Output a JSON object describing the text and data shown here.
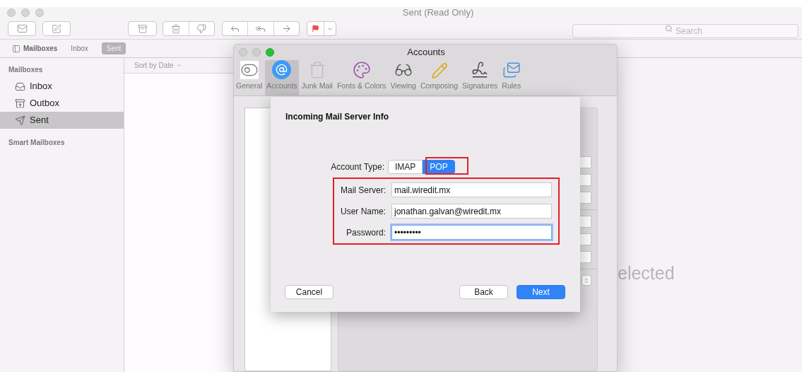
{
  "window": {
    "title": "Sent (Read Only)"
  },
  "toolbar": {
    "search": {
      "placeholder": "Search"
    }
  },
  "favorites_bar": {
    "mailboxes_button": "Mailboxes",
    "items": [
      {
        "label": "Inbox",
        "selected": false
      },
      {
        "label": "Sent",
        "selected": true
      }
    ]
  },
  "sidebar": {
    "heading": "Mailboxes",
    "items": [
      {
        "label": "Inbox",
        "kind": "inbox",
        "selected": false
      },
      {
        "label": "Outbox",
        "kind": "outbox",
        "selected": false
      },
      {
        "label": "Sent",
        "kind": "sent",
        "selected": true
      }
    ],
    "smart_heading": "Smart Mailboxes"
  },
  "message_list": {
    "sort": "Sort by Date"
  },
  "viewer": {
    "empty_text": "elected"
  },
  "accounts_window": {
    "title": "Accounts",
    "tabs": [
      {
        "label": "General",
        "kind": "general",
        "selected": false
      },
      {
        "label": "Accounts",
        "kind": "accounts",
        "selected": true
      },
      {
        "label": "Junk Mail",
        "kind": "junk",
        "selected": false
      },
      {
        "label": "Fonts & Colors",
        "kind": "fonts",
        "selected": false
      },
      {
        "label": "Viewing",
        "kind": "viewing",
        "selected": false
      },
      {
        "label": "Composing",
        "kind": "composing",
        "selected": false
      },
      {
        "label": "Signatures",
        "kind": "signatures",
        "selected": false
      },
      {
        "label": "Rules",
        "kind": "rules",
        "selected": false
      }
    ],
    "sheet": {
      "title": "Incoming Mail Server Info",
      "account_type": {
        "label": "Account Type:",
        "options": [
          {
            "label": "IMAP",
            "selected": false
          },
          {
            "label": "POP",
            "selected": true
          }
        ]
      },
      "fields": [
        {
          "label": "Mail Server:",
          "value": "mail.wiredit.mx",
          "focused": false
        },
        {
          "label": "User Name:",
          "value": "jonathan.galvan@wiredit.mx",
          "focused": false
        },
        {
          "label": "Password:",
          "value": "•••••••••",
          "focused": true
        }
      ],
      "buttons": [
        {
          "label": "Cancel",
          "kind": "plain"
        },
        {
          "label": "Back",
          "kind": "plain"
        },
        {
          "label": "Next",
          "kind": "default"
        }
      ]
    }
  }
}
